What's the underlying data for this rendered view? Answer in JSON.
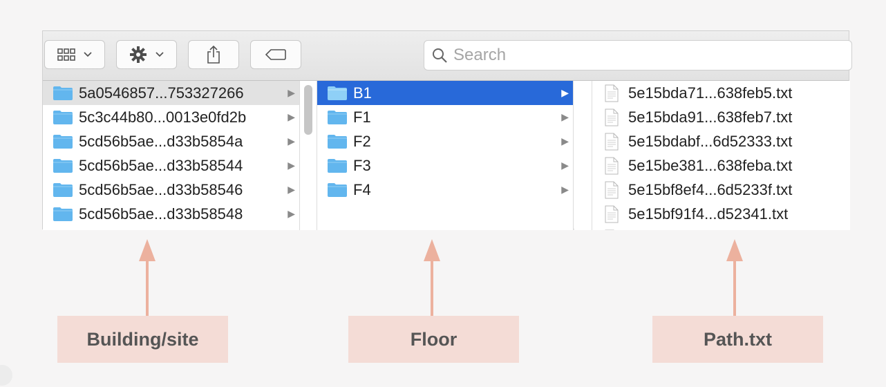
{
  "search": {
    "placeholder": "Search"
  },
  "columns": {
    "buildings": [
      "5a0546857...753327266",
      "5c3c44b80...0013e0fd2b",
      "5cd56b5ae...d33b5854a",
      "5cd56b5ae...d33b58544",
      "5cd56b5ae...d33b58546",
      "5cd56b5ae...d33b58548"
    ],
    "floors": [
      "B1",
      "F1",
      "F2",
      "F3",
      "F4"
    ],
    "files": [
      "5e15bda71...638feb5.txt",
      "5e15bda91...638feb7.txt",
      "5e15bdabf...6d52333.txt",
      "5e15be381...638feba.txt",
      "5e15bf8ef4...6d5233f.txt",
      "5e15bf91f4...d52341.txt"
    ]
  },
  "annotations": {
    "building": "Building/site",
    "floor": "Floor",
    "path": "Path.txt"
  },
  "colors": {
    "selection": "#2869d9",
    "folder": "#62b6ee",
    "annotation_box": "#f4dcd6",
    "annotation_arrow": "#ecb19e"
  },
  "icons": {
    "view": "icon-view-grid-icon",
    "action": "gear-icon",
    "share": "share-icon",
    "tag": "tag-icon",
    "search": "search-icon",
    "folder": "folder-icon",
    "file": "document-icon"
  }
}
